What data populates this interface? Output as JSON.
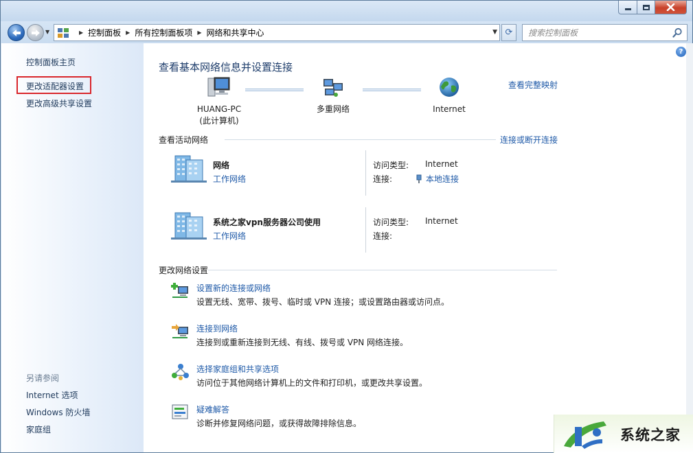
{
  "window": {
    "accent": "#1f5aa8",
    "close_color": "#c8412a"
  },
  "navbar": {
    "breadcrumbs": [
      "控制面板",
      "所有控制面板项",
      "网络和共享中心"
    ],
    "search_placeholder": "搜索控制面板"
  },
  "sidebar": {
    "home": "控制面板主页",
    "adapter": "更改适配器设置",
    "advanced": "更改高级共享设置",
    "see_also": "另请参阅",
    "internet_options": "Internet 选项",
    "firewall": "Windows 防火墙",
    "homegroup": "家庭组"
  },
  "main": {
    "title": "查看基本网络信息并设置连接",
    "full_map": "查看完整映射",
    "map": {
      "pc_name": "HUANG-PC",
      "pc_sub": "(此计算机)",
      "multi": "多重网络",
      "internet": "Internet"
    },
    "active_networks": {
      "heading": "查看活动网络",
      "connect_link": "连接或断开连接",
      "networks": [
        {
          "name": "网络",
          "type": "工作网络",
          "access_label": "访问类型:",
          "access_value": "Internet",
          "conn_label": "连接:",
          "conn_value": "本地连接"
        },
        {
          "name": "系统之家vpn服务器公司使用",
          "type": "工作网络",
          "access_label": "访问类型:",
          "access_value": "Internet",
          "conn_label": "连接:"
        }
      ]
    },
    "change_settings": {
      "heading": "更改网络设置",
      "tasks": [
        {
          "link": "设置新的连接或网络",
          "desc": "设置无线、宽带、拨号、临时或 VPN 连接；或设置路由器或访问点。",
          "icon": "new-connection-icon"
        },
        {
          "link": "连接到网络",
          "desc": "连接到或重新连接到无线、有线、拨号或 VPN 网络连接。",
          "icon": "connect-network-icon"
        },
        {
          "link": "选择家庭组和共享选项",
          "desc": "访问位于其他网络计算机上的文件和打印机，或更改共享设置。",
          "icon": "homegroup-icon"
        },
        {
          "link": "疑难解答",
          "desc": "诊断并修复网络问题，或获得故障排除信息。",
          "icon": "troubleshoot-icon"
        }
      ]
    }
  },
  "watermark": {
    "text": "系统之家"
  }
}
